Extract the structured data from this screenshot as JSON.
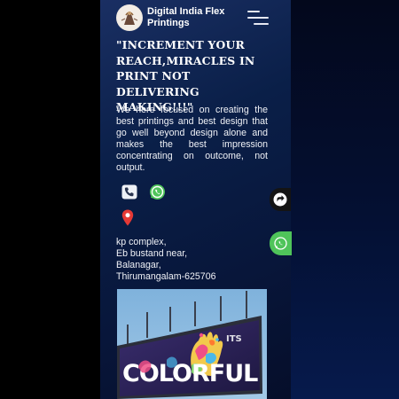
{
  "header": {
    "brand_line1": "Digital India Flex",
    "brand_line2": "Printings",
    "menu_icon": "hamburger-menu-icon",
    "logo_icon": "logo-emblem"
  },
  "hero": {
    "headline_lines": [
      "\"INCREMENT YOUR",
      "REACH,MIRACLES IN",
      "PRINT NOT DELIVERING",
      "MAKING!!!\""
    ],
    "description": "We here focused on creating the best printings and best design that go well beyond design alone and makes the best impression concentrating on outcome, not output."
  },
  "contacts": {
    "phone_icon": "phone-icon",
    "whatsapp_icon": "whatsapp-icon",
    "location_icon": "location-pin-icon"
  },
  "address": {
    "lines": [
      "kp complex,",
      "Eb bustand near,",
      "Balanagar,",
      "Thirumangalam-625706"
    ]
  },
  "billboard": {
    "small_text": "ITS",
    "big_text": "COLORFUL"
  },
  "floating": {
    "share_icon": "share-icon",
    "whatsapp_icon": "whatsapp-icon"
  },
  "colors": {
    "background": "#0a1f48",
    "whatsapp": "#4fc45a",
    "location": "#e53935"
  }
}
